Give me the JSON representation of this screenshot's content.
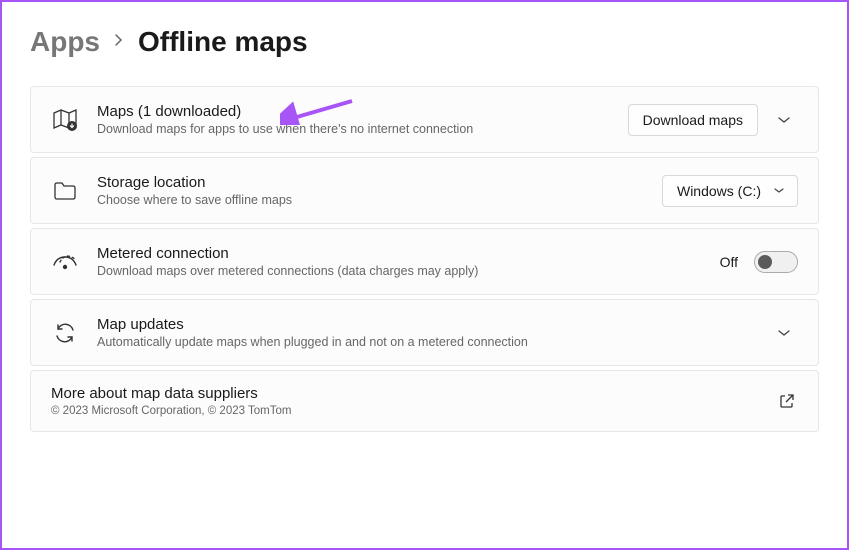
{
  "breadcrumb": {
    "parent": "Apps",
    "current": "Offline maps"
  },
  "cards": {
    "maps": {
      "title": "Maps (1 downloaded)",
      "subtitle": "Download maps for apps to use when there's no internet connection",
      "button": "Download maps"
    },
    "storage": {
      "title": "Storage location",
      "subtitle": "Choose where to save offline maps",
      "dropdown": "Windows (C:)"
    },
    "metered": {
      "title": "Metered connection",
      "subtitle": "Download maps over metered connections (data charges may apply)",
      "state": "Off"
    },
    "updates": {
      "title": "Map updates",
      "subtitle": "Automatically update maps when plugged in and not on a metered connection"
    },
    "suppliers": {
      "title": "More about map data suppliers",
      "subtitle": "© 2023 Microsoft Corporation, © 2023 TomTom"
    }
  }
}
